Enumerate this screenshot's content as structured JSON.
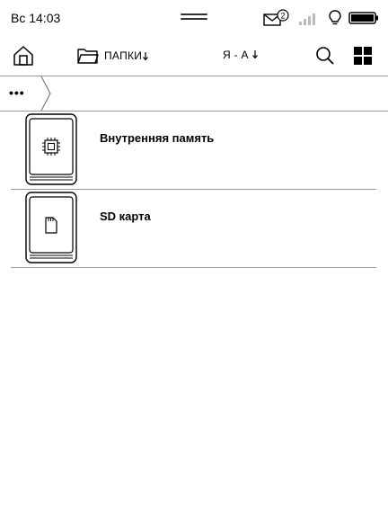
{
  "status_bar": {
    "time": "Вс 14:03",
    "mail_count": "2"
  },
  "toolbar": {
    "folders_label": "ПАПКИ",
    "sort_label": "Я - А"
  },
  "breadcrumb": {
    "more": "•••"
  },
  "items": [
    {
      "label": "Внутренняя память",
      "icon": "chip-icon"
    },
    {
      "label": "SD карта",
      "icon": "sd-card-icon"
    }
  ]
}
